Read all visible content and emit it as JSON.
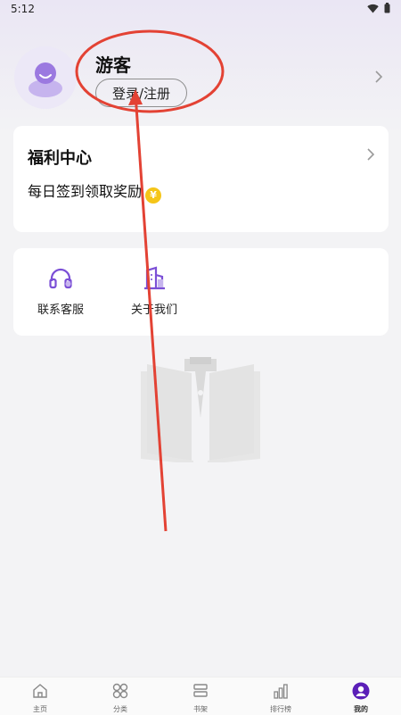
{
  "status_bar": {
    "time": "5:12",
    "icons": [
      "wifi-icon",
      "battery-icon"
    ]
  },
  "profile": {
    "username": "游客",
    "login_label": "登录/注册",
    "avatar_icon": "user-avatar-icon"
  },
  "welfare": {
    "title": "福利中心",
    "subtitle": "每日签到领取奖励",
    "coin_symbol": "¥"
  },
  "services": [
    {
      "label": "联系客服",
      "icon": "headset-icon"
    },
    {
      "label": "关于我们",
      "icon": "building-icon"
    }
  ],
  "bottom_nav": [
    {
      "label": "主页",
      "icon": "home-icon"
    },
    {
      "label": "分类",
      "icon": "category-icon"
    },
    {
      "label": "书架",
      "icon": "bookshelf-icon"
    },
    {
      "label": "排行榜",
      "icon": "ranking-icon"
    },
    {
      "label": "我的",
      "icon": "profile-icon",
      "active": true
    }
  ],
  "colors": {
    "accent": "#7b4fd6",
    "annotation": "#e34234",
    "coin": "#f5c518"
  }
}
